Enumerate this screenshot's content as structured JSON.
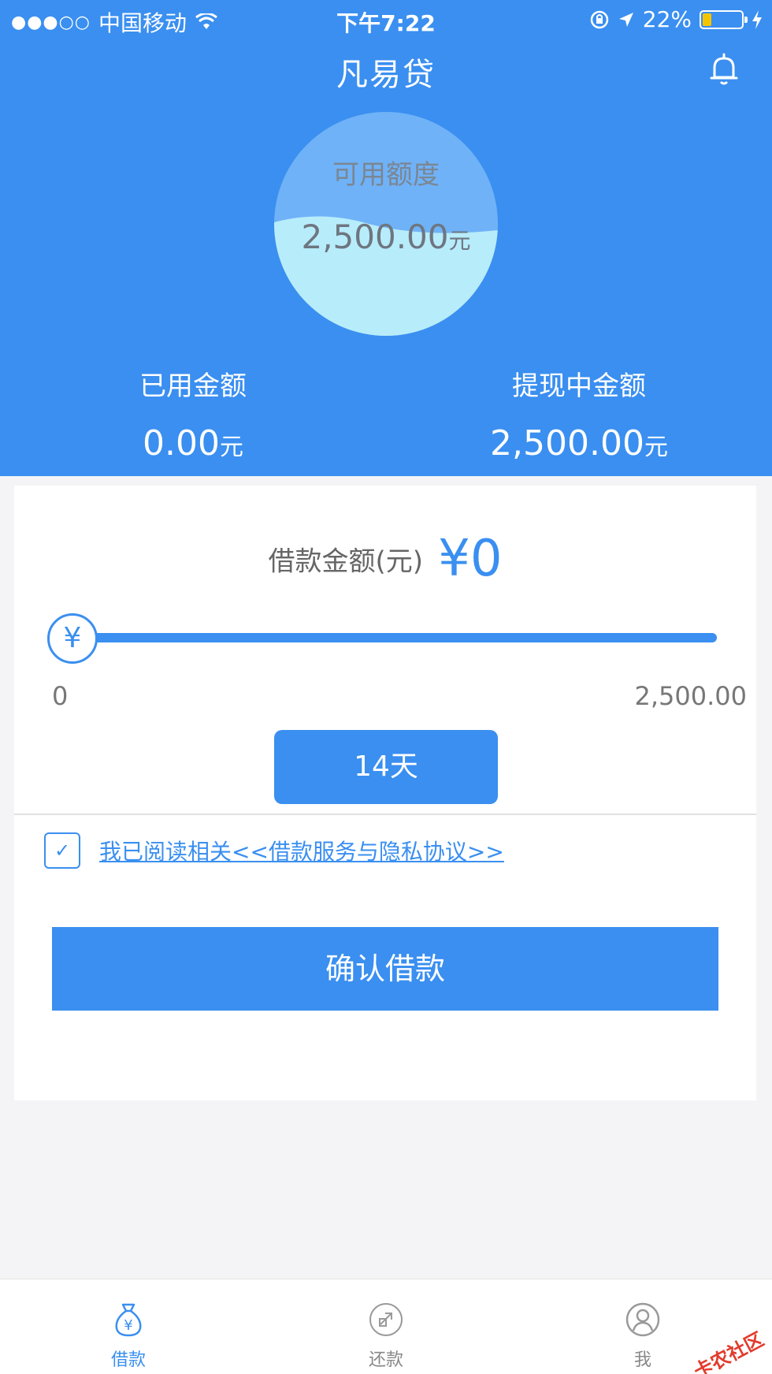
{
  "status_bar": {
    "signal": "●●●○○",
    "carrier": "中国移动",
    "time": "下午7:22",
    "battery_percent": "22%",
    "battery_level": 0.22
  },
  "header": {
    "title": "凡易贷",
    "bell_icon": "bell-icon"
  },
  "gauge": {
    "label": "可用额度",
    "value": "2,500.00",
    "unit": "元",
    "fill_fraction": 0.5
  },
  "stats": {
    "used_label": "已用金额",
    "used_value": "0.00",
    "used_unit": "元",
    "withdrawing_label": "提现中金额",
    "withdrawing_value": "2,500.00",
    "withdrawing_unit": "元"
  },
  "loan": {
    "amount_label": "借款金额(元)",
    "amount_value": "¥0",
    "slider_symbol": "¥",
    "slider_value": 0,
    "range_min": "0",
    "range_max": "2,500.00",
    "term_label": "14天",
    "agreement_text": "我已阅读相关<<借款服务与隐私协议>>",
    "agreement_checked": true,
    "check_mark": "✓",
    "confirm_label": "确认借款"
  },
  "tabs": [
    {
      "label": "借款",
      "icon": "money-bag-icon",
      "active": true
    },
    {
      "label": "还款",
      "icon": "repay-icon",
      "active": false
    },
    {
      "label": "我",
      "icon": "user-icon",
      "active": false
    }
  ],
  "watermark": "卡农社区",
  "colors": {
    "primary": "#3a8ff0",
    "gauge_top": "#6fb2f7",
    "gauge_wave": "#b7ecfb",
    "background": "#f4f4f6"
  }
}
